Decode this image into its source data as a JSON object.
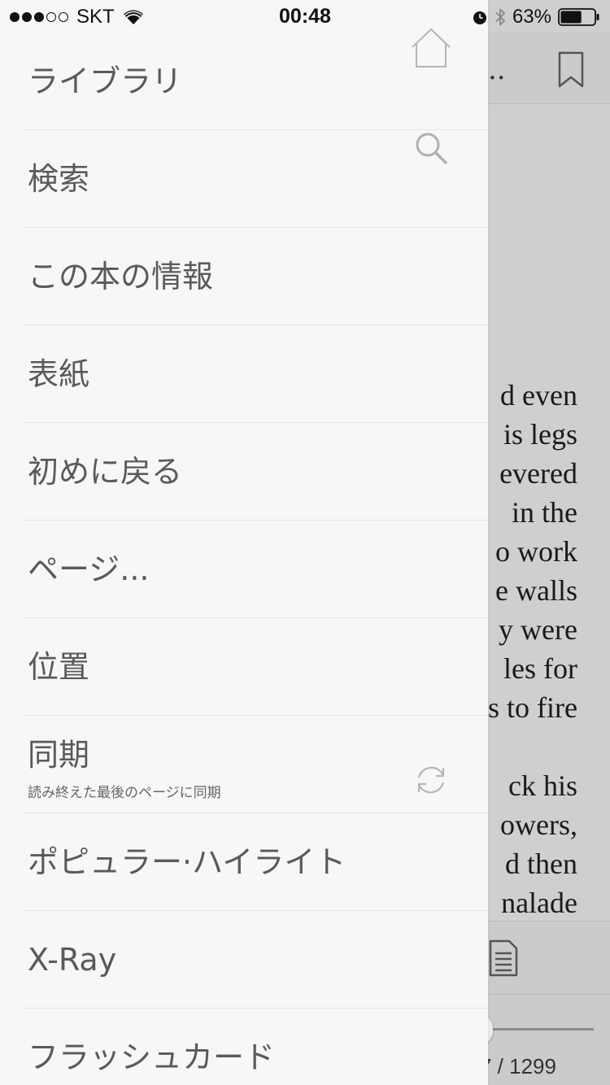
{
  "status_bar": {
    "carrier": "SKT",
    "time": "00:48",
    "battery_percent": "63%",
    "battery_level": 0.63,
    "signal_bars_filled": 3,
    "signal_bars_total": 5
  },
  "reader": {
    "title_fragment": "..",
    "text_lines": [
      "d even",
      "is legs",
      "evered",
      "in the",
      "o work",
      "e walls",
      "y were",
      "les for",
      "s to fire",
      "",
      "ck his",
      "owers,",
      "d then",
      "nalade"
    ],
    "page_count": "7 / 1299"
  },
  "menu": {
    "items": [
      {
        "label": "ライブラリ",
        "icon": "home-icon"
      },
      {
        "label": "検索",
        "icon": "search-icon"
      },
      {
        "label": "この本の情報"
      },
      {
        "label": "表紙"
      },
      {
        "label": "初めに戻る"
      },
      {
        "label": "ページ..."
      },
      {
        "label": "位置"
      },
      {
        "label": "同期",
        "sublabel": "読み終えた最後のページに同期",
        "icon": "sync-icon"
      },
      {
        "label": "ポピュラー·ハイライト"
      },
      {
        "label": "X-Ray"
      },
      {
        "label": "フラッシュカード"
      }
    ]
  },
  "colors": {
    "drawer_bg": "#f7f7f7",
    "reader_bg": "#cfcfcf",
    "menu_text": "#5a5a5a",
    "icon_gray": "#b5b5b5"
  }
}
